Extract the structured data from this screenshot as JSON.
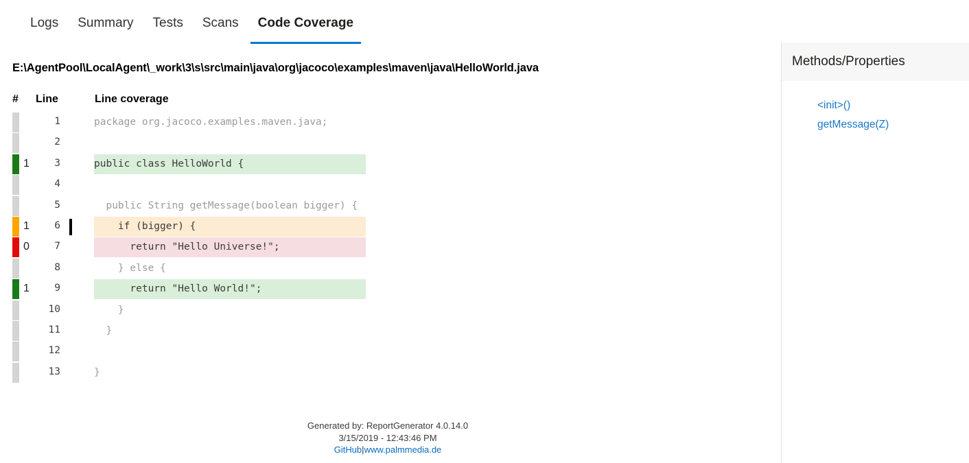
{
  "tabs": [
    {
      "label": "Logs",
      "active": false
    },
    {
      "label": "Summary",
      "active": false
    },
    {
      "label": "Tests",
      "active": false
    },
    {
      "label": "Scans",
      "active": false
    },
    {
      "label": "Code Coverage",
      "active": true
    }
  ],
  "file": {
    "path": "E:\\AgentPool\\LocalAgent\\_work\\3\\s\\src\\main\\java\\org\\jacoco\\examples\\maven\\java\\HelloWorld.java"
  },
  "table": {
    "headers": {
      "hits": "#",
      "line": "Line",
      "coverage": "Line coverage"
    },
    "rows": [
      {
        "hits": "",
        "line": "1",
        "code": "package org.jacoco.examples.maven.java;",
        "coverage": "none",
        "branch_tick": false
      },
      {
        "hits": "",
        "line": "2",
        "code": "",
        "coverage": "none",
        "branch_tick": false
      },
      {
        "hits": "1",
        "line": "3",
        "code": "public class HelloWorld {",
        "coverage": "covered",
        "branch_tick": false
      },
      {
        "hits": "",
        "line": "4",
        "code": "",
        "coverage": "none",
        "branch_tick": false
      },
      {
        "hits": "",
        "line": "5",
        "code": "  public String getMessage(boolean bigger) {",
        "coverage": "none",
        "branch_tick": false
      },
      {
        "hits": "1",
        "line": "6",
        "code": "    if (bigger) {",
        "coverage": "partial",
        "branch_tick": true
      },
      {
        "hits": "0",
        "line": "7",
        "code": "      return \"Hello Universe!\";",
        "coverage": "uncovered",
        "branch_tick": false
      },
      {
        "hits": "",
        "line": "8",
        "code": "    } else {",
        "coverage": "none",
        "branch_tick": false
      },
      {
        "hits": "1",
        "line": "9",
        "code": "      return \"Hello World!\";",
        "coverage": "covered",
        "branch_tick": false
      },
      {
        "hits": "",
        "line": "10",
        "code": "    }",
        "coverage": "none",
        "branch_tick": false
      },
      {
        "hits": "",
        "line": "11",
        "code": "  }",
        "coverage": "none",
        "branch_tick": false
      },
      {
        "hits": "",
        "line": "12",
        "code": "",
        "coverage": "none",
        "branch_tick": false
      },
      {
        "hits": "",
        "line": "13",
        "code": "}",
        "coverage": "none",
        "branch_tick": false
      }
    ]
  },
  "footer": {
    "generated_by": "Generated by: ReportGenerator 4.0.14.0",
    "timestamp": "3/15/2019 - 12:43:46 PM",
    "github_link": "GitHub",
    "separator": "|",
    "site_link": "www.palmmedia.de"
  },
  "sidebar": {
    "title": "Methods/Properties",
    "links": [
      {
        "label": "<init>()"
      },
      {
        "label": "getMessage(Z)"
      }
    ]
  },
  "colors": {
    "accent": "#0078d4",
    "covered": "#1a7a1a",
    "partial": "#ffa500",
    "uncovered": "#e00c0c",
    "neutral_gutter": "#d4d4d4",
    "covered_bg": "#daefd9",
    "partial_bg": "#fdebd2",
    "uncovered_bg": "#f5dde1",
    "link": "#1878c8"
  }
}
